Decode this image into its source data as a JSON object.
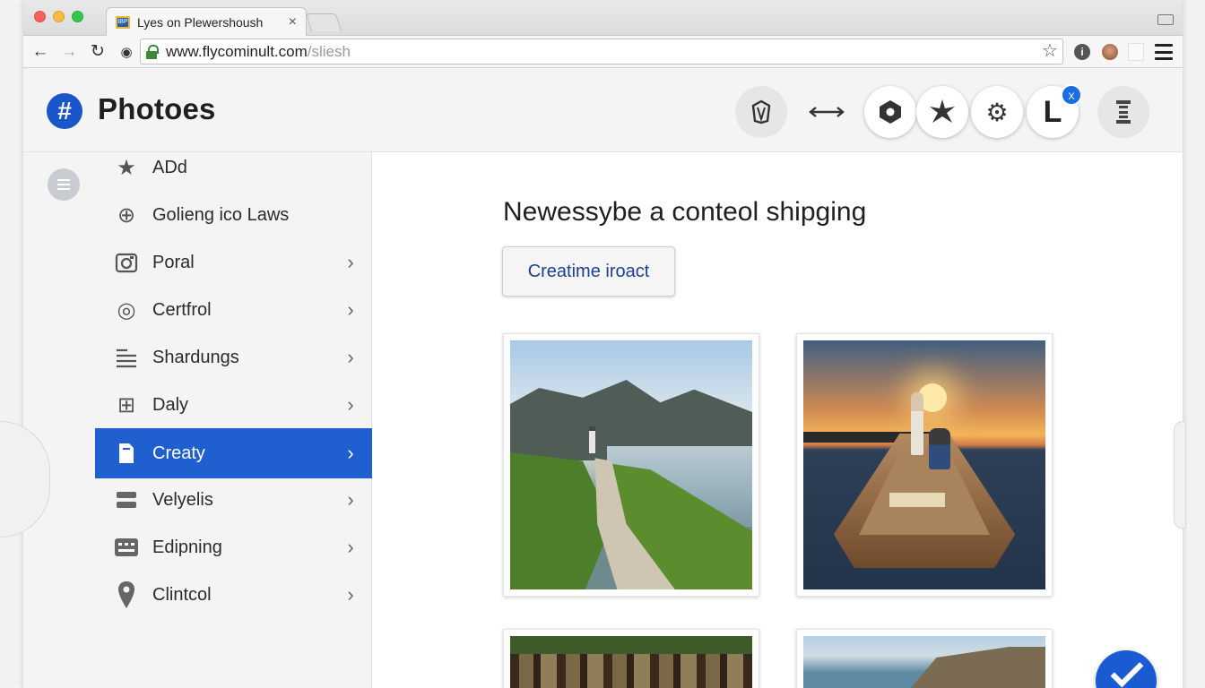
{
  "browser": {
    "tab_title": "Lyes on Plewershoush",
    "tab_close": "×",
    "url_main": "www.flycominult.com",
    "url_path": "/sliesh",
    "favicon_text": "IBP"
  },
  "app": {
    "logo_glyph": "#",
    "title": "Photoes",
    "avatar_letter": "L",
    "avatar_badge": "X",
    "accent_color": "#1f5fcf"
  },
  "header_icons": [
    "crest-icon",
    "resize-horizontal-icon",
    "hexagon-settings-icon",
    "star-burst-icon",
    "gear-icon",
    "avatar",
    "hourglass-icon"
  ],
  "sidebar": {
    "items": [
      {
        "label": "ADd",
        "icon": "star-icon",
        "chevron": false,
        "active": false
      },
      {
        "label": "Golieng ico Laws",
        "icon": "plus-circle-icon",
        "chevron": false,
        "active": false
      },
      {
        "label": "Poral",
        "icon": "camera-icon",
        "chevron": true,
        "active": false
      },
      {
        "label": "Certfrol",
        "icon": "target-icon",
        "chevron": true,
        "active": false
      },
      {
        "label": "Shardungs",
        "icon": "list-icon",
        "chevron": true,
        "active": false
      },
      {
        "label": "Daly",
        "icon": "plus-square-icon",
        "chevron": true,
        "active": false
      },
      {
        "label": "Creaty",
        "icon": "document-icon",
        "chevron": true,
        "active": true
      },
      {
        "label": "Velyelis",
        "icon": "layers-icon",
        "chevron": true,
        "active": false
      },
      {
        "label": "Edipning",
        "icon": "keyboard-icon",
        "chevron": true,
        "active": false
      },
      {
        "label": "Clintcol",
        "icon": "location-pin-icon",
        "chevron": true,
        "active": false
      }
    ]
  },
  "main": {
    "heading": "Newessybe a conteol shipging",
    "create_button": "Creatime iroact",
    "photos": [
      "coastal-path-photo",
      "sunset-boat-photo",
      "forest-photo",
      "cliff-coast-photo"
    ]
  }
}
